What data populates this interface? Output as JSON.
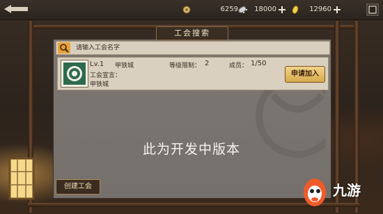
{
  "resources": [
    {
      "icon": "coin-icon",
      "value": "6259"
    },
    {
      "icon": "silver-icon",
      "value": "18000"
    },
    {
      "icon": "gold-bar-icon",
      "value": "12960"
    }
  ],
  "panel": {
    "title": "工会搜索",
    "search_placeholder": "请输入工会名字"
  },
  "guild": {
    "level": "Lv.1",
    "name": "甲铁城",
    "level_limit_label": "等级限制：",
    "level_limit_value": "2",
    "members_label": "成员：",
    "members_value": "1/50",
    "declaration_label": "工会宣言：",
    "declaration": "甲铁城",
    "join_label": "申请加入"
  },
  "dev_notice": "此为开发中版本",
  "create_label": "创建工会",
  "watermark_logo": "九游",
  "colors": {
    "accent": "#e8a23a",
    "panel": "#7a7570",
    "row": "#d9d0bf",
    "frame_wood": "#4a3220"
  }
}
